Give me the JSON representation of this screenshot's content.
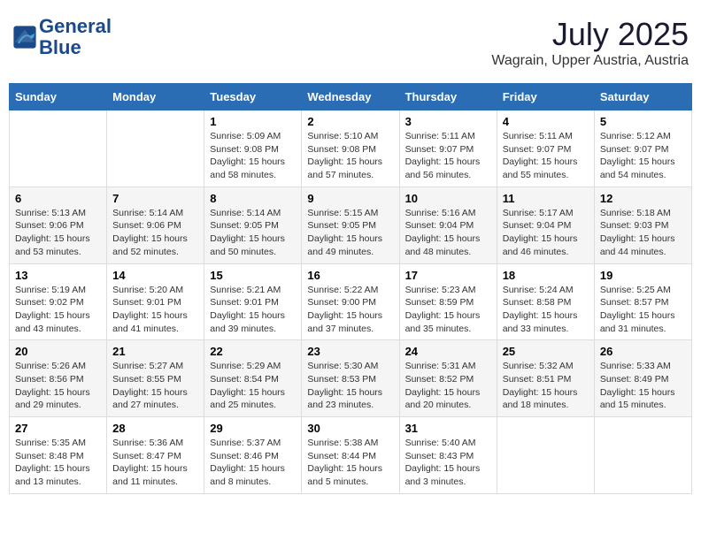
{
  "header": {
    "logo_line1": "General",
    "logo_line2": "Blue",
    "month": "July 2025",
    "location": "Wagrain, Upper Austria, Austria"
  },
  "weekdays": [
    "Sunday",
    "Monday",
    "Tuesday",
    "Wednesday",
    "Thursday",
    "Friday",
    "Saturday"
  ],
  "weeks": [
    [
      {
        "day": "",
        "info": ""
      },
      {
        "day": "",
        "info": ""
      },
      {
        "day": "1",
        "info": "Sunrise: 5:09 AM\nSunset: 9:08 PM\nDaylight: 15 hours\nand 58 minutes."
      },
      {
        "day": "2",
        "info": "Sunrise: 5:10 AM\nSunset: 9:08 PM\nDaylight: 15 hours\nand 57 minutes."
      },
      {
        "day": "3",
        "info": "Sunrise: 5:11 AM\nSunset: 9:07 PM\nDaylight: 15 hours\nand 56 minutes."
      },
      {
        "day": "4",
        "info": "Sunrise: 5:11 AM\nSunset: 9:07 PM\nDaylight: 15 hours\nand 55 minutes."
      },
      {
        "day": "5",
        "info": "Sunrise: 5:12 AM\nSunset: 9:07 PM\nDaylight: 15 hours\nand 54 minutes."
      }
    ],
    [
      {
        "day": "6",
        "info": "Sunrise: 5:13 AM\nSunset: 9:06 PM\nDaylight: 15 hours\nand 53 minutes."
      },
      {
        "day": "7",
        "info": "Sunrise: 5:14 AM\nSunset: 9:06 PM\nDaylight: 15 hours\nand 52 minutes."
      },
      {
        "day": "8",
        "info": "Sunrise: 5:14 AM\nSunset: 9:05 PM\nDaylight: 15 hours\nand 50 minutes."
      },
      {
        "day": "9",
        "info": "Sunrise: 5:15 AM\nSunset: 9:05 PM\nDaylight: 15 hours\nand 49 minutes."
      },
      {
        "day": "10",
        "info": "Sunrise: 5:16 AM\nSunset: 9:04 PM\nDaylight: 15 hours\nand 48 minutes."
      },
      {
        "day": "11",
        "info": "Sunrise: 5:17 AM\nSunset: 9:04 PM\nDaylight: 15 hours\nand 46 minutes."
      },
      {
        "day": "12",
        "info": "Sunrise: 5:18 AM\nSunset: 9:03 PM\nDaylight: 15 hours\nand 44 minutes."
      }
    ],
    [
      {
        "day": "13",
        "info": "Sunrise: 5:19 AM\nSunset: 9:02 PM\nDaylight: 15 hours\nand 43 minutes."
      },
      {
        "day": "14",
        "info": "Sunrise: 5:20 AM\nSunset: 9:01 PM\nDaylight: 15 hours\nand 41 minutes."
      },
      {
        "day": "15",
        "info": "Sunrise: 5:21 AM\nSunset: 9:01 PM\nDaylight: 15 hours\nand 39 minutes."
      },
      {
        "day": "16",
        "info": "Sunrise: 5:22 AM\nSunset: 9:00 PM\nDaylight: 15 hours\nand 37 minutes."
      },
      {
        "day": "17",
        "info": "Sunrise: 5:23 AM\nSunset: 8:59 PM\nDaylight: 15 hours\nand 35 minutes."
      },
      {
        "day": "18",
        "info": "Sunrise: 5:24 AM\nSunset: 8:58 PM\nDaylight: 15 hours\nand 33 minutes."
      },
      {
        "day": "19",
        "info": "Sunrise: 5:25 AM\nSunset: 8:57 PM\nDaylight: 15 hours\nand 31 minutes."
      }
    ],
    [
      {
        "day": "20",
        "info": "Sunrise: 5:26 AM\nSunset: 8:56 PM\nDaylight: 15 hours\nand 29 minutes."
      },
      {
        "day": "21",
        "info": "Sunrise: 5:27 AM\nSunset: 8:55 PM\nDaylight: 15 hours\nand 27 minutes."
      },
      {
        "day": "22",
        "info": "Sunrise: 5:29 AM\nSunset: 8:54 PM\nDaylight: 15 hours\nand 25 minutes."
      },
      {
        "day": "23",
        "info": "Sunrise: 5:30 AM\nSunset: 8:53 PM\nDaylight: 15 hours\nand 23 minutes."
      },
      {
        "day": "24",
        "info": "Sunrise: 5:31 AM\nSunset: 8:52 PM\nDaylight: 15 hours\nand 20 minutes."
      },
      {
        "day": "25",
        "info": "Sunrise: 5:32 AM\nSunset: 8:51 PM\nDaylight: 15 hours\nand 18 minutes."
      },
      {
        "day": "26",
        "info": "Sunrise: 5:33 AM\nSunset: 8:49 PM\nDaylight: 15 hours\nand 15 minutes."
      }
    ],
    [
      {
        "day": "27",
        "info": "Sunrise: 5:35 AM\nSunset: 8:48 PM\nDaylight: 15 hours\nand 13 minutes."
      },
      {
        "day": "28",
        "info": "Sunrise: 5:36 AM\nSunset: 8:47 PM\nDaylight: 15 hours\nand 11 minutes."
      },
      {
        "day": "29",
        "info": "Sunrise: 5:37 AM\nSunset: 8:46 PM\nDaylight: 15 hours\nand 8 minutes."
      },
      {
        "day": "30",
        "info": "Sunrise: 5:38 AM\nSunset: 8:44 PM\nDaylight: 15 hours\nand 5 minutes."
      },
      {
        "day": "31",
        "info": "Sunrise: 5:40 AM\nSunset: 8:43 PM\nDaylight: 15 hours\nand 3 minutes."
      },
      {
        "day": "",
        "info": ""
      },
      {
        "day": "",
        "info": ""
      }
    ]
  ]
}
